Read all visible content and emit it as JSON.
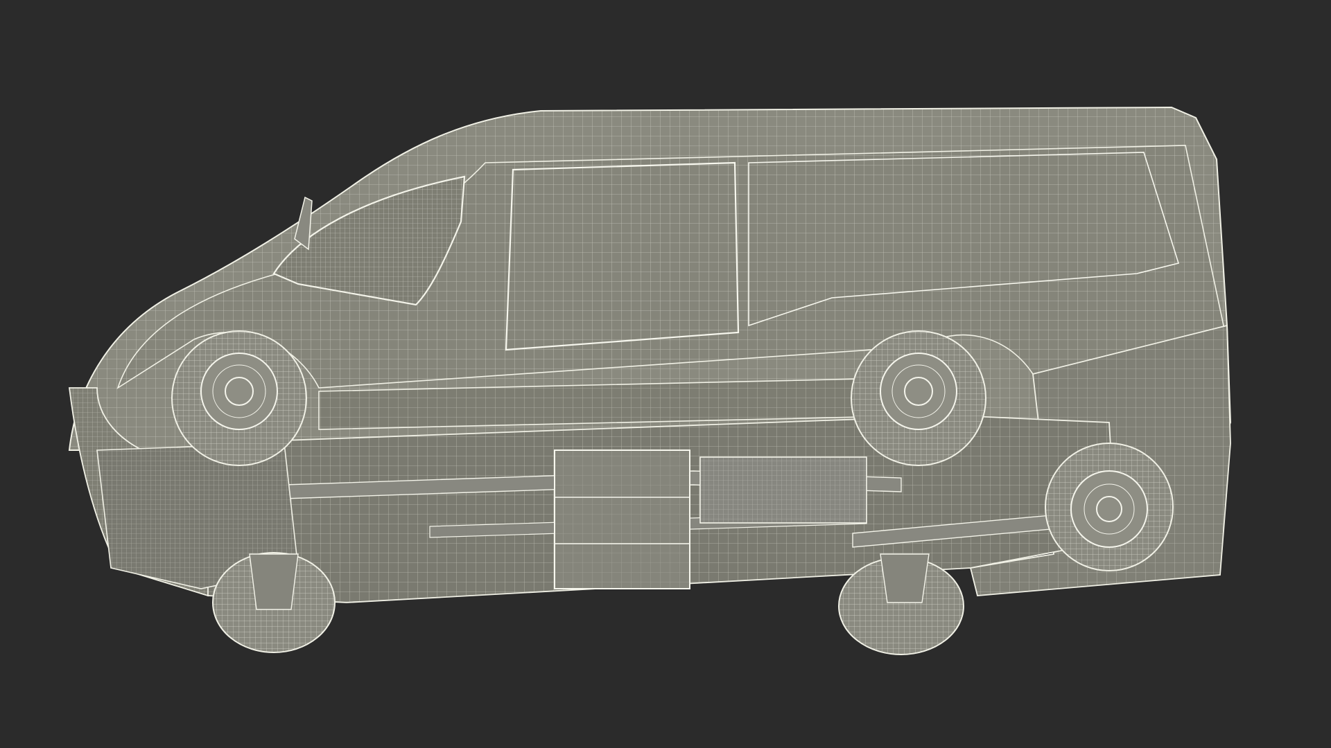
{
  "scene": {
    "background_color": "#2b2b2b",
    "model_fill_color": "#8b8b80",
    "wireframe_color": "#f1f1e6"
  }
}
